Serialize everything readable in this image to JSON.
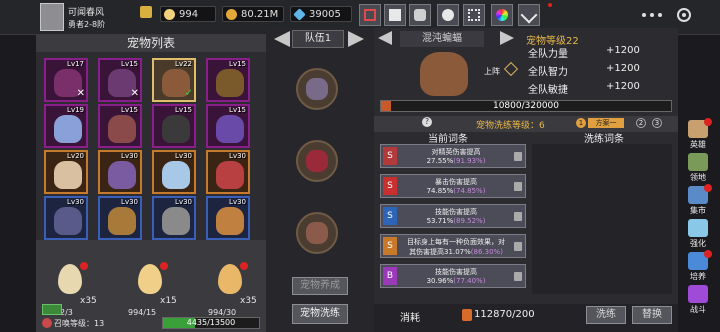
{
  "topbar": {
    "player_name": "可闻春风",
    "rank": "勇者2-8阶",
    "resources": [
      {
        "icon": "egg-coin-icon",
        "value": "994",
        "color": "#f0d27a"
      },
      {
        "icon": "gold-coin-icon",
        "value": "80.21M",
        "color": "#e2a83a"
      },
      {
        "icon": "diamond-icon",
        "value": "39005",
        "color": "#5fb6e8"
      }
    ],
    "toolbar_icons": [
      "shop-cart-icon",
      "mail-icon",
      "gamepad-icon",
      "settings-gear-icon",
      "grid-icon",
      "color-wheel-icon",
      "swords-icon"
    ]
  },
  "left": {
    "title": "宠物列表",
    "pets": [
      {
        "level": "Lv17",
        "frame": "purple",
        "color": "#7a2f6a",
        "mark": "x"
      },
      {
        "level": "Lv15",
        "frame": "purple",
        "color": "#6a3a70",
        "mark": "x"
      },
      {
        "level": "Lv22",
        "frame": "selected",
        "color": "#8a5a3a",
        "mark": "check"
      },
      {
        "level": "Lv15",
        "frame": "purple",
        "color": "#7a5a2a",
        "mark": ""
      },
      {
        "level": "Lv19",
        "frame": "purple",
        "color": "#8aa0d8",
        "mark": ""
      },
      {
        "level": "Lv15",
        "frame": "purple",
        "color": "#8a4a4a",
        "mark": ""
      },
      {
        "level": "Lv15",
        "frame": "purple",
        "color": "#3a3a3a",
        "mark": ""
      },
      {
        "level": "Lv15",
        "frame": "purple",
        "color": "#6a4aa8",
        "mark": ""
      },
      {
        "level": "Lv20",
        "frame": "orange",
        "color": "#d8c0a0",
        "mark": ""
      },
      {
        "level": "Lv30",
        "frame": "orange",
        "color": "#7a5aa0",
        "mark": ""
      },
      {
        "level": "Lv30",
        "frame": "orange",
        "color": "#a8c8e8",
        "mark": ""
      },
      {
        "level": "Lv30",
        "frame": "orange",
        "color": "#b84040",
        "mark": ""
      },
      {
        "level": "Lv30",
        "frame": "blue",
        "color": "#5a5a8a",
        "mark": ""
      },
      {
        "level": "Lv30",
        "frame": "blue",
        "color": "#a87a3a",
        "mark": ""
      },
      {
        "level": "Lv30",
        "frame": "blue",
        "color": "#8a8a8a",
        "mark": ""
      },
      {
        "level": "Lv30",
        "frame": "blue",
        "color": "#c08040",
        "mark": ""
      }
    ],
    "eggs": [
      {
        "count": "x35",
        "progress": "2/3",
        "color": "#e8d8b0"
      },
      {
        "count": "x15",
        "progress": "994/15",
        "color": "#f0d088"
      },
      {
        "count": "x35",
        "progress": "994/30",
        "color": "#e8b868"
      }
    ],
    "summon_label": "召唤等级：13",
    "summon_progress": "4435/13500",
    "summon_fraction": 0.33
  },
  "middle": {
    "team_label": "队伍1",
    "slot_colors": [
      "#7a6a8a",
      "#9a2a3a",
      "#8a5a4a"
    ],
    "incubate_button": "宠物养成",
    "wash_button": "宠物洗练"
  },
  "right": {
    "pet_name": "混沌蝙蝠",
    "pet_level": "宠物等级22",
    "battle_label": "上阵",
    "stats": [
      {
        "name": "全队力量",
        "value": "+1200"
      },
      {
        "name": "全队智力",
        "value": "+1200"
      },
      {
        "name": "全队敏捷",
        "value": "+1200"
      }
    ],
    "exp_text": "10800/320000",
    "exp_fraction": 0.034,
    "wash_level": "宠物洗练等级：6",
    "schemes": [
      {
        "num": "1",
        "label": "方案一"
      },
      {
        "num": "2",
        "label": ""
      },
      {
        "num": "3",
        "label": ""
      }
    ],
    "tab_current": "当前词条",
    "tab_wash": "洗练词条",
    "entries": [
      {
        "letter": "S",
        "icon_color": "#b23a3a",
        "line1": "对精英伤害提高",
        "line2_main": "27.55%",
        "line2_range": "(91.93%)"
      },
      {
        "letter": "S",
        "icon_color": "#c83030",
        "line1": "暴击伤害提高",
        "line2_main": "74.85%",
        "line2_range": "(74.85%)"
      },
      {
        "letter": "S",
        "icon_color": "#2e64b8",
        "line1": "技能伤害提高",
        "line2_main": "53.71%",
        "line2_range": "(89.52%)"
      },
      {
        "letter": "S",
        "icon_color": "#c87a2a",
        "line1": "目标身上每有一种负面效果，对",
        "line2_main": "其伤害提高31.07%",
        "line2_range": "(86.30%)"
      },
      {
        "letter": "B",
        "icon_color": "#9a3ab8",
        "line1": "技能伤害提高",
        "line2_main": "30.96%",
        "line2_range": "(77.40%)"
      }
    ],
    "consume_label": "消耗",
    "consume_value": "112870/200",
    "wash_button": "洗练",
    "replace_button": "替换"
  },
  "sidebar": [
    {
      "label": "英雄",
      "color": "#c8a070",
      "badge": true
    },
    {
      "label": "领地",
      "color": "#7a9a5a",
      "badge": false
    },
    {
      "label": "集市",
      "color": "#5a8ac8",
      "badge": true
    },
    {
      "label": "强化",
      "color": "#8ac8e8",
      "badge": false
    },
    {
      "label": "培养",
      "color": "#4a8ad8",
      "badge": true
    },
    {
      "label": "战斗",
      "color": "#a04ad8",
      "badge": false
    }
  ]
}
